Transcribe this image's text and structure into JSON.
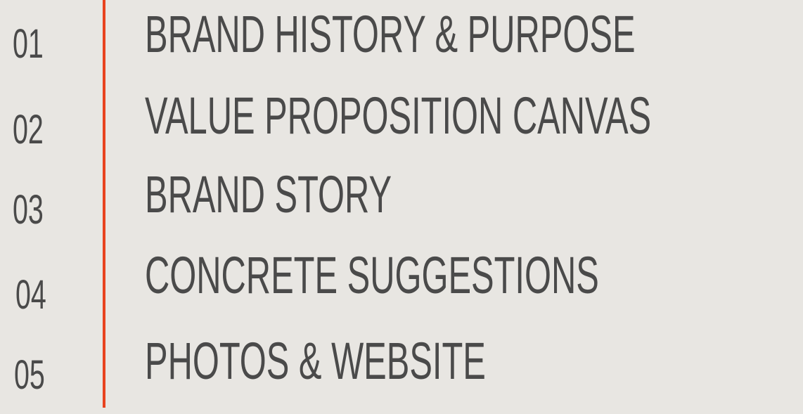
{
  "accent_color": "#e8431f",
  "text_color": "#4a4a4a",
  "background_color": "#e8e6e2",
  "agenda": {
    "items": [
      {
        "number": "01",
        "title": "BRAND HISTORY & PURPOSE"
      },
      {
        "number": "02",
        "title": "VALUE PROPOSITION CANVAS"
      },
      {
        "number": "03",
        "title": "BRAND STORY"
      },
      {
        "number": "04",
        "title": "CONCRETE SUGGESTIONS"
      },
      {
        "number": "05",
        "title": "PHOTOS & WEBSITE"
      }
    ]
  }
}
